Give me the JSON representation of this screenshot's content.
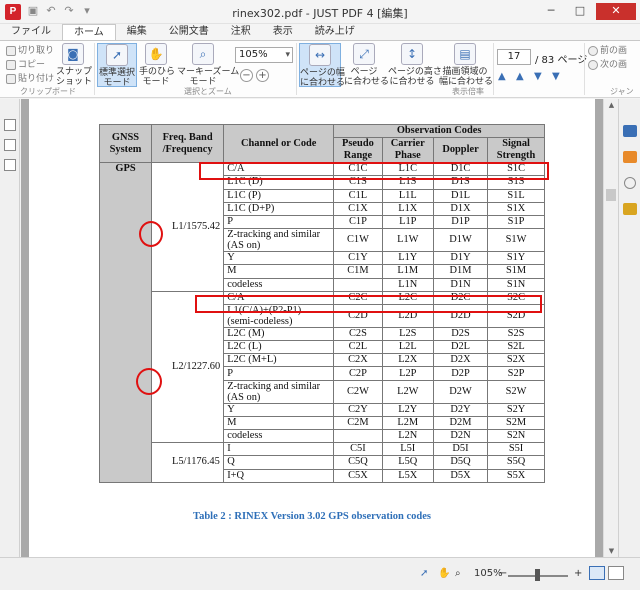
{
  "window": {
    "title": "rinex302.pdf - JUST PDF 4 [編集]",
    "buttons": {
      "minimize": "─",
      "maximize": "□",
      "close": "✕"
    }
  },
  "menu_tabs": [
    "ファイル",
    "ホーム",
    "編集",
    "公開文書",
    "注釈",
    "表示",
    "読み上げ"
  ],
  "ribbon": {
    "clipboard": {
      "cut": "切り取り",
      "copy": "コピー",
      "paste": "貼り付け",
      "snapshot": "スナップ\nショット",
      "label": "クリップボード"
    },
    "select_zoom": {
      "standard_select": "標準選択\nモード",
      "hand": "手のひら\nモード",
      "marquee_zoom": "マーキーズーム\nモード",
      "label": "選択とズーム"
    },
    "zoom_value": "105%",
    "zoom_out": "−",
    "zoom_in": "+",
    "display_ratio": {
      "fit_width": "ページの幅\nに合わせる",
      "fit_page": "ページ\nに合わせる",
      "fit_height": "ページの高さ\nに合わせる",
      "fit_drawing": "描画領域の\n幅に合わせる",
      "label": "表示倍率"
    },
    "page_number": "17",
    "page_total": "/ 83 ページ",
    "prev_page": "前の画",
    "next_page": "次の画",
    "jump_label": "ジャン"
  },
  "table": {
    "headers": {
      "system": "GNSS\nSystem",
      "band": "Freq. Band\n/Frequency",
      "channel": "Channel or Code",
      "obs": "Observation Codes",
      "pseudo": "Pseudo\nRange",
      "carrier": "Carrier\nPhase",
      "doppler": "Doppler",
      "signal": "Signal\nStrength"
    },
    "system": "GPS",
    "bands": [
      {
        "name": "L1/1575.42",
        "rows": [
          [
            "C/A",
            "C1C",
            "L1C",
            "D1C",
            "S1C"
          ],
          [
            "L1C (D)",
            "C1S",
            "L1S",
            "D1S",
            "S1S"
          ],
          [
            "L1C (P)",
            "C1L",
            "L1L",
            "D1L",
            "S1L"
          ],
          [
            "L1C (D+P)",
            "C1X",
            "L1X",
            "D1X",
            "S1X"
          ],
          [
            "P",
            "C1P",
            "L1P",
            "D1P",
            "S1P"
          ],
          [
            "Z-tracking and similar\n(AS on)",
            "C1W",
            "L1W",
            "D1W",
            "S1W"
          ],
          [
            "Y",
            "C1Y",
            "L1Y",
            "D1Y",
            "S1Y"
          ],
          [
            "M",
            "C1M",
            "L1M",
            "D1M",
            "S1M"
          ],
          [
            "codeless",
            "",
            "L1N",
            "D1N",
            "S1N"
          ]
        ]
      },
      {
        "name": "L2/1227.60",
        "rows": [
          [
            "C/A",
            "C2C",
            "L2C",
            "D2C",
            "S2C"
          ],
          [
            "L1(C/A)+(P2-P1)\n(semi-codeless)",
            "C2D",
            "L2D",
            "D2D",
            "S2D"
          ],
          [
            "L2C (M)",
            "C2S",
            "L2S",
            "D2S",
            "S2S"
          ],
          [
            "L2C (L)",
            "C2L",
            "L2L",
            "D2L",
            "S2L"
          ],
          [
            "L2C (M+L)",
            "C2X",
            "L2X",
            "D2X",
            "S2X"
          ],
          [
            "P",
            "C2P",
            "L2P",
            "D2P",
            "S2P"
          ],
          [
            "Z-tracking and similar\n(AS on)",
            "C2W",
            "L2W",
            "D2W",
            "S2W"
          ],
          [
            "Y",
            "C2Y",
            "L2Y",
            "D2Y",
            "S2Y"
          ],
          [
            "M",
            "C2M",
            "L2M",
            "D2M",
            "S2M"
          ],
          [
            "codeless",
            "",
            "L2N",
            "D2N",
            "S2N"
          ]
        ]
      },
      {
        "name": "L5/1176.45",
        "rows": [
          [
            "I",
            "C5I",
            "L5I",
            "D5I",
            "S5I"
          ],
          [
            "Q",
            "C5Q",
            "L5Q",
            "D5Q",
            "S5Q"
          ],
          [
            "I+Q",
            "C5X",
            "L5X",
            "D5X",
            "S5X"
          ]
        ]
      }
    ],
    "caption": "Table 2 : RINEX Version 3.02 GPS observation codes"
  },
  "statusbar": {
    "zoom": "105%",
    "minus": "−",
    "plus": "+"
  },
  "colors": {
    "highlight": "#e01010",
    "caption": "#2e6fb8",
    "header_gray": "#c9c9c9"
  }
}
